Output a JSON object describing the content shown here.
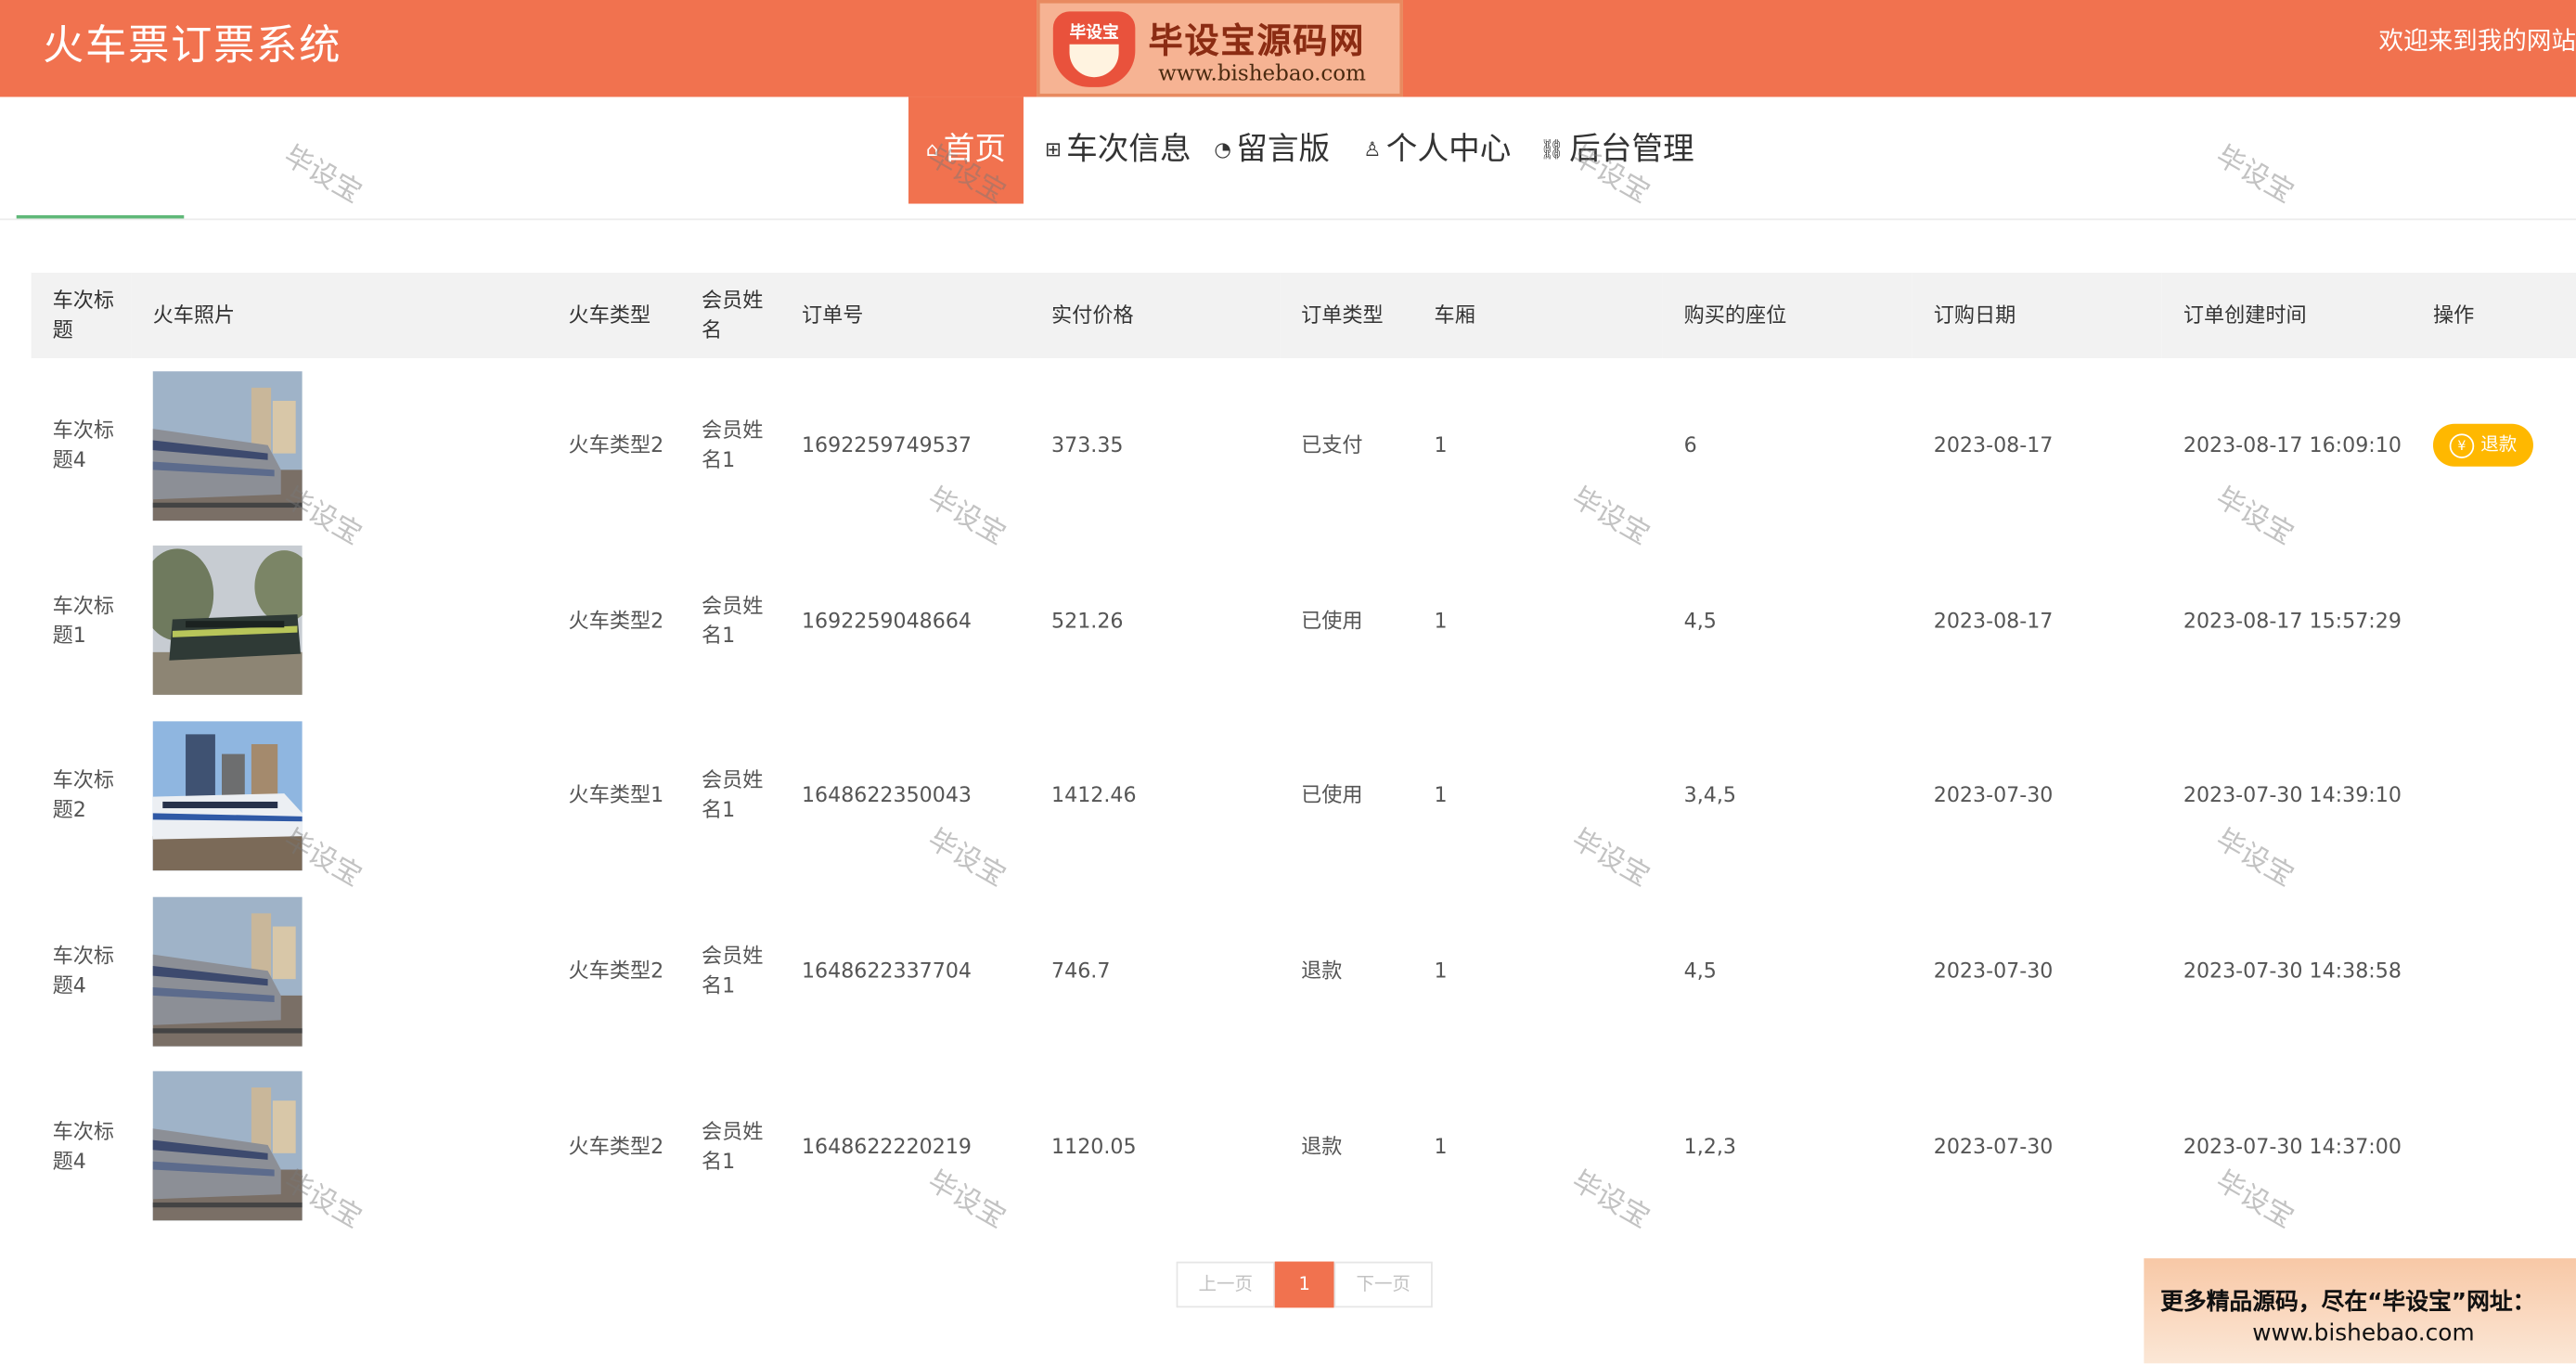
{
  "header": {
    "site_title": "火车票订票系统",
    "welcome_text": "欢迎来到我的网站",
    "logo": {
      "badge": "毕设宝",
      "brand": "毕设宝源码网",
      "url": "www.bishebao.com"
    },
    "background_color": "#f1724f"
  },
  "nav": {
    "items": [
      {
        "label": "首页",
        "icon": "home-icon",
        "active": true
      },
      {
        "label": "车次信息",
        "icon": "gift-icon",
        "active": false
      },
      {
        "label": "留言版",
        "icon": "dashboard-icon",
        "active": false
      },
      {
        "label": "个人中心",
        "icon": "user-icon",
        "active": false
      },
      {
        "label": "后台管理",
        "icon": "link-icon",
        "active": false
      }
    ]
  },
  "table": {
    "columns": [
      "车次标题",
      "火车照片",
      "火车类型",
      "会员姓名",
      "订单号",
      "实付价格",
      "订单类型",
      "车厢",
      "购买的座位",
      "订购日期",
      "订单创建时间",
      "操作"
    ],
    "rows": [
      {
        "title": "车次标题4",
        "photo": "train-photo-4",
        "type": "火车类型2",
        "member": "会员姓名1",
        "order_no": "1692259749537",
        "price": "373.35",
        "status": "已支付",
        "carriage": "1",
        "seats": "6",
        "date": "2023-08-17",
        "created": "2023-08-17 16:09:10",
        "action": "退款"
      },
      {
        "title": "车次标题1",
        "photo": "train-photo-1",
        "type": "火车类型2",
        "member": "会员姓名1",
        "order_no": "1692259048664",
        "price": "521.26",
        "status": "已使用",
        "carriage": "1",
        "seats": "4,5",
        "date": "2023-08-17",
        "created": "2023-08-17 15:57:29",
        "action": ""
      },
      {
        "title": "车次标题2",
        "photo": "train-photo-2",
        "type": "火车类型1",
        "member": "会员姓名1",
        "order_no": "1648622350043",
        "price": "1412.46",
        "status": "已使用",
        "carriage": "1",
        "seats": "3,4,5",
        "date": "2023-07-30",
        "created": "2023-07-30 14:39:10",
        "action": ""
      },
      {
        "title": "车次标题4",
        "photo": "train-photo-4",
        "type": "火车类型2",
        "member": "会员姓名1",
        "order_no": "1648622337704",
        "price": "746.7",
        "status": "退款",
        "carriage": "1",
        "seats": "4,5",
        "date": "2023-07-30",
        "created": "2023-07-30 14:38:58",
        "action": ""
      },
      {
        "title": "车次标题4",
        "photo": "train-photo-4",
        "type": "火车类型2",
        "member": "会员姓名1",
        "order_no": "1648622220219",
        "price": "1120.05",
        "status": "退款",
        "carriage": "1",
        "seats": "1,2,3",
        "date": "2023-07-30",
        "created": "2023-07-30 14:37:00",
        "action": ""
      }
    ],
    "refund_icon": "yen-icon"
  },
  "pagination": {
    "prev_label": "上一页",
    "current_page": "1",
    "next_label": "下一页"
  },
  "watermark": {
    "text": "毕设宝"
  },
  "ad_banner": {
    "line1": "更多精品源码，尽在“毕设宝”网址：",
    "line2": "www.bishebao.com"
  }
}
